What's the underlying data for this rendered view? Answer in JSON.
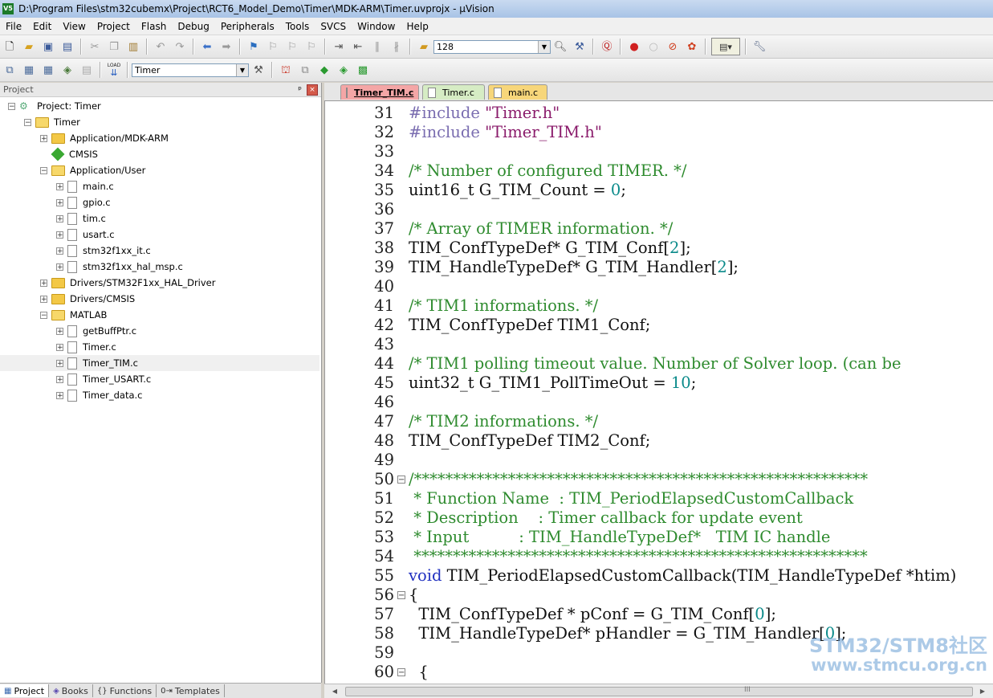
{
  "window": {
    "title": "D:\\Program Files\\stm32cubemx\\Project\\RCT6_Model_Demo\\Timer\\MDK-ARM\\Timer.uvprojx - µVision",
    "icon_text": "V5"
  },
  "menubar": {
    "items": [
      "File",
      "Edit",
      "View",
      "Project",
      "Flash",
      "Debug",
      "Peripherals",
      "Tools",
      "SVCS",
      "Window",
      "Help"
    ]
  },
  "toolbar1": {
    "find_combo_value": "128"
  },
  "toolbar2": {
    "target_combo_value": "Timer",
    "load_label": "LOAD"
  },
  "project_panel": {
    "title": "Project",
    "pin_glyph": "ᵖ",
    "close_glyph": "×",
    "tree": [
      {
        "label": "Project: Timer",
        "type": "project",
        "expander": "−"
      },
      {
        "label": "Timer",
        "type": "folder-open",
        "expander": "−"
      },
      {
        "label": "Application/MDK-ARM",
        "type": "folder",
        "expander": "+"
      },
      {
        "label": "CMSIS",
        "type": "cmsis",
        "expander": ""
      },
      {
        "label": "Application/User",
        "type": "folder-open",
        "expander": "−"
      },
      {
        "label": "main.c",
        "type": "file",
        "expander": "+"
      },
      {
        "label": "gpio.c",
        "type": "file",
        "expander": "+"
      },
      {
        "label": "tim.c",
        "type": "file",
        "expander": "+"
      },
      {
        "label": "usart.c",
        "type": "file",
        "expander": "+"
      },
      {
        "label": "stm32f1xx_it.c",
        "type": "file",
        "expander": "+"
      },
      {
        "label": "stm32f1xx_hal_msp.c",
        "type": "file",
        "expander": "+"
      },
      {
        "label": "Drivers/STM32F1xx_HAL_Driver",
        "type": "folder",
        "expander": "+"
      },
      {
        "label": "Drivers/CMSIS",
        "type": "folder",
        "expander": "+"
      },
      {
        "label": "MATLAB",
        "type": "folder-open",
        "expander": "−"
      },
      {
        "label": "getBuffPtr.c",
        "type": "file",
        "expander": "+"
      },
      {
        "label": "Timer.c",
        "type": "file",
        "expander": "+"
      },
      {
        "label": "Timer_TIM.c",
        "type": "file",
        "expander": "+",
        "selected": true
      },
      {
        "label": "Timer_USART.c",
        "type": "file",
        "expander": "+"
      },
      {
        "label": "Timer_data.c",
        "type": "file",
        "expander": "+"
      }
    ],
    "bottom_tabs": [
      {
        "label": "Project",
        "icon": "▦",
        "active": true
      },
      {
        "label": "Books",
        "icon": "◈",
        "active": false
      },
      {
        "label": "Functions",
        "icon": "{}",
        "active": false
      },
      {
        "label": "Templates",
        "icon": "0⇥",
        "active": false
      }
    ]
  },
  "editor": {
    "tabs": [
      {
        "label": "Timer_TIM.c",
        "active": true,
        "color": "#f4a6a6"
      },
      {
        "label": "Timer.c",
        "active": false,
        "color": "#d6ecc4"
      },
      {
        "label": "main.c",
        "active": false,
        "color": "#f7d67a"
      }
    ],
    "lines": [
      {
        "n": "31",
        "fold": "",
        "segs": [
          [
            "pp",
            "#include "
          ],
          [
            "str",
            "\"Timer.h\""
          ]
        ]
      },
      {
        "n": "32",
        "fold": "",
        "segs": [
          [
            "pp",
            "#include "
          ],
          [
            "str",
            "\"Timer_TIM.h\""
          ]
        ]
      },
      {
        "n": "33",
        "fold": "",
        "segs": []
      },
      {
        "n": "34",
        "fold": "",
        "segs": [
          [
            "comment",
            "/* Number of configured TIMER. */"
          ]
        ]
      },
      {
        "n": "35",
        "fold": "",
        "segs": [
          [
            "plain",
            "uint16_t G_TIM_Count = "
          ],
          [
            "num",
            "0"
          ],
          [
            "plain",
            ";"
          ]
        ]
      },
      {
        "n": "36",
        "fold": "",
        "segs": []
      },
      {
        "n": "37",
        "fold": "",
        "segs": [
          [
            "comment",
            "/* Array of TIMER information. */"
          ]
        ]
      },
      {
        "n": "38",
        "fold": "",
        "segs": [
          [
            "plain",
            "TIM_ConfTypeDef* G_TIM_Conf["
          ],
          [
            "num",
            "2"
          ],
          [
            "plain",
            "];"
          ]
        ]
      },
      {
        "n": "39",
        "fold": "",
        "segs": [
          [
            "plain",
            "TIM_HandleTypeDef* G_TIM_Handler["
          ],
          [
            "num",
            "2"
          ],
          [
            "plain",
            "];"
          ]
        ]
      },
      {
        "n": "40",
        "fold": "",
        "segs": []
      },
      {
        "n": "41",
        "fold": "",
        "segs": [
          [
            "comment",
            "/* TIM1 informations. */"
          ]
        ]
      },
      {
        "n": "42",
        "fold": "",
        "segs": [
          [
            "plain",
            "TIM_ConfTypeDef TIM1_Conf;"
          ]
        ]
      },
      {
        "n": "43",
        "fold": "",
        "segs": []
      },
      {
        "n": "44",
        "fold": "",
        "segs": [
          [
            "comment",
            "/* TIM1 polling timeout value. Number of Solver loop. (can be"
          ]
        ]
      },
      {
        "n": "45",
        "fold": "",
        "segs": [
          [
            "plain",
            "uint32_t G_TIM1_PollTimeOut = "
          ],
          [
            "num",
            "10"
          ],
          [
            "plain",
            ";"
          ]
        ]
      },
      {
        "n": "46",
        "fold": "",
        "segs": []
      },
      {
        "n": "47",
        "fold": "",
        "segs": [
          [
            "comment",
            "/* TIM2 informations. */"
          ]
        ]
      },
      {
        "n": "48",
        "fold": "",
        "segs": [
          [
            "plain",
            "TIM_ConfTypeDef TIM2_Conf;"
          ]
        ]
      },
      {
        "n": "49",
        "fold": "",
        "segs": []
      },
      {
        "n": "50",
        "fold": "−",
        "segs": [
          [
            "comment",
            "/**********************************************************"
          ]
        ]
      },
      {
        "n": "51",
        "fold": "",
        "segs": [
          [
            "comment",
            " * Function Name  : TIM_PeriodElapsedCustomCallback"
          ]
        ]
      },
      {
        "n": "52",
        "fold": "",
        "segs": [
          [
            "comment",
            " * Description    : Timer callback for update event"
          ]
        ]
      },
      {
        "n": "53",
        "fold": "",
        "segs": [
          [
            "comment",
            " * Input          : TIM_HandleTypeDef*   TIM IC handle"
          ]
        ]
      },
      {
        "n": "54",
        "fold": "",
        "segs": [
          [
            "comment",
            " **********************************************************"
          ]
        ]
      },
      {
        "n": "55",
        "fold": "",
        "segs": [
          [
            "kw",
            "void"
          ],
          [
            "plain",
            " TIM_PeriodElapsedCustomCallback(TIM_HandleTypeDef *htim)"
          ]
        ]
      },
      {
        "n": "56",
        "fold": "−",
        "segs": [
          [
            "plain",
            "{"
          ]
        ]
      },
      {
        "n": "57",
        "fold": "",
        "segs": [
          [
            "plain",
            "  TIM_ConfTypeDef * pConf = G_TIM_Conf["
          ],
          [
            "num",
            "0"
          ],
          [
            "plain",
            "];"
          ]
        ]
      },
      {
        "n": "58",
        "fold": "",
        "segs": [
          [
            "plain",
            "  TIM_HandleTypeDef* pHandler = G_TIM_Handler["
          ],
          [
            "num",
            "0"
          ],
          [
            "plain",
            "];"
          ]
        ]
      },
      {
        "n": "59",
        "fold": "",
        "segs": []
      },
      {
        "n": "60",
        "fold": "−",
        "segs": [
          [
            "plain",
            "  {"
          ]
        ]
      }
    ]
  },
  "scrollbar": {
    "left_arrow": "◀",
    "right_arrow": "▶",
    "grip": "III"
  },
  "watermark": {
    "line1": "STM32/STM8社区",
    "line2": "www.stmcu.org.cn"
  }
}
